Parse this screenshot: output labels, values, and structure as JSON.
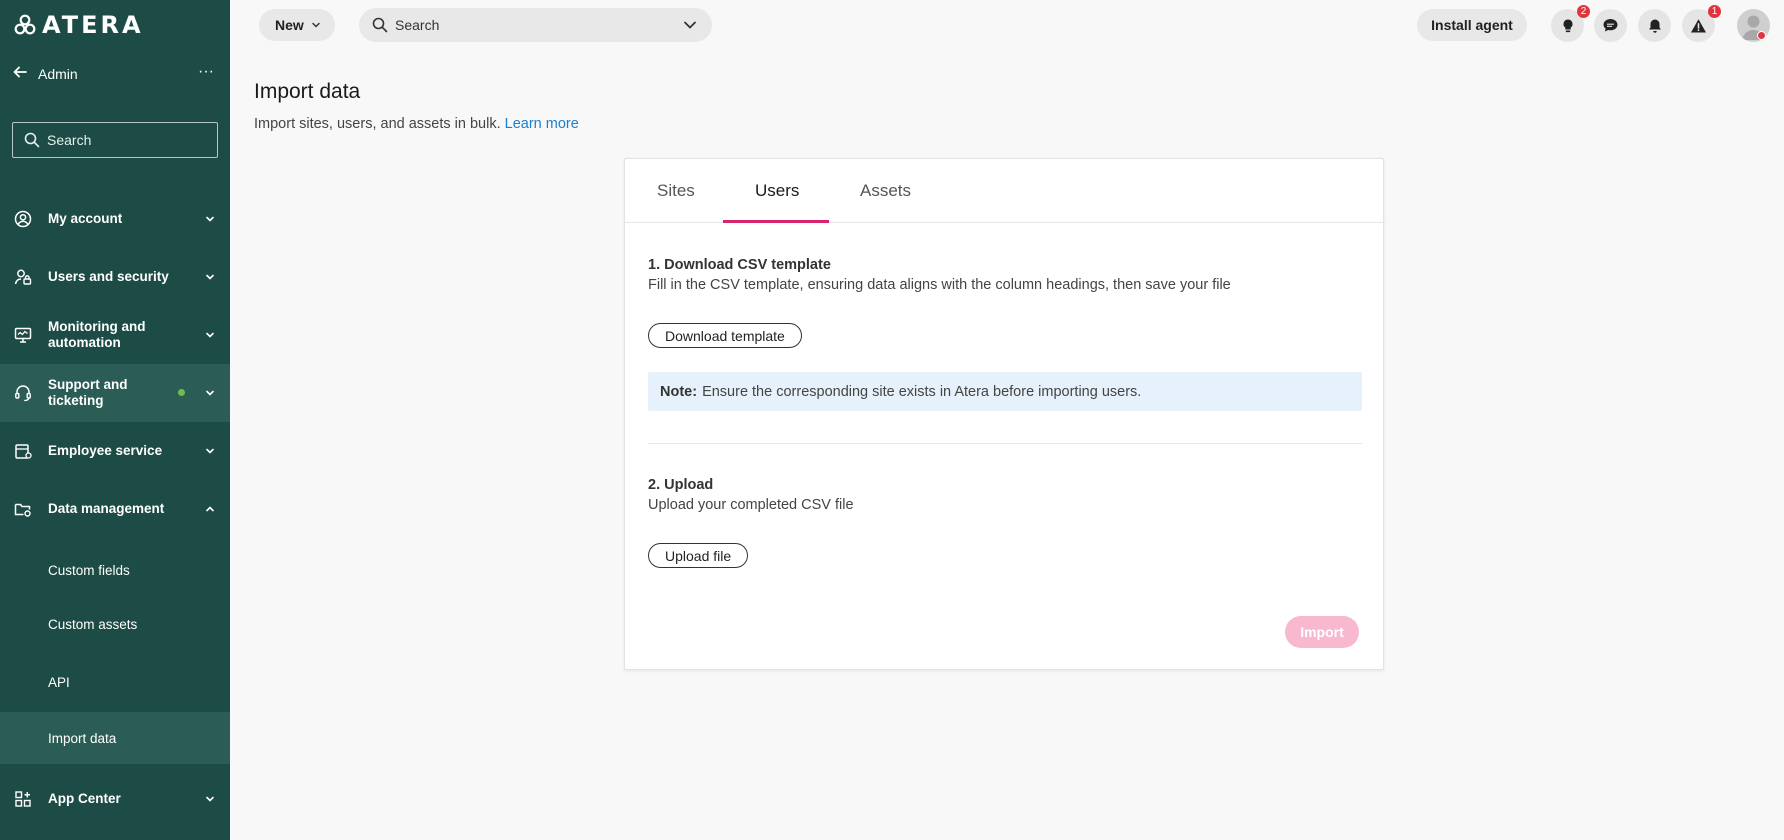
{
  "app": {
    "logo_text": "ATERA"
  },
  "sidebar": {
    "header_label": "Admin",
    "search_placeholder": "Search",
    "items": [
      {
        "label": "My account"
      },
      {
        "label": "Users and security"
      },
      {
        "label": "Monitoring and automation"
      },
      {
        "label": "Support and ticketing"
      },
      {
        "label": "Employee service"
      },
      {
        "label": "Data management"
      },
      {
        "label": "App Center"
      }
    ],
    "sub_items": [
      {
        "label": "Custom fields"
      },
      {
        "label": "Custom assets"
      },
      {
        "label": "API"
      },
      {
        "label": "Import data"
      }
    ]
  },
  "topbar": {
    "new_label": "New",
    "search_label": "Search",
    "install_label": "Install agent",
    "badges": {
      "ideas": "2",
      "alerts": "1"
    }
  },
  "page": {
    "title": "Import data",
    "subtitle": "Import sites, users, and assets in bulk.",
    "learn_more": "Learn more"
  },
  "card": {
    "tabs": [
      {
        "label": "Sites"
      },
      {
        "label": "Users"
      },
      {
        "label": "Assets"
      }
    ],
    "active_tab": "Users",
    "step1_title": "1. Download CSV template",
    "step1_desc": "Fill in the CSV template, ensuring data aligns with the column headings, then save your file",
    "download_label": "Download template",
    "note_label": "Note:",
    "note_text": "Ensure the corresponding site exists in Atera before importing users.",
    "step2_title": "2. Upload",
    "step2_desc": "Upload your completed CSV file",
    "upload_label": "Upload file",
    "import_label": "Import"
  },
  "colors": {
    "sidebar_bg": "#1d4b45",
    "accent": "#d6246e",
    "link": "#1e7fcc",
    "import_disabled": "#f8b8cf",
    "status_dot": "#6cc04a"
  }
}
